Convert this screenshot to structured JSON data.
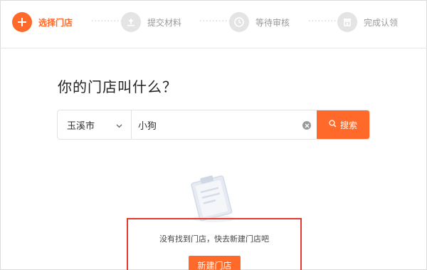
{
  "steps": [
    {
      "label": "选择门店",
      "icon": "plus-icon",
      "state": "active"
    },
    {
      "label": "提交材料",
      "icon": "upload-icon",
      "state": "inactive"
    },
    {
      "label": "等待审核",
      "icon": "clock-icon",
      "state": "inactive"
    },
    {
      "label": "完成认领",
      "icon": "store-icon",
      "state": "inactive"
    }
  ],
  "step_separator": "··········",
  "title": "你的门店叫什么？",
  "search": {
    "city": "玉溪市",
    "query": "小狗",
    "button_label": "搜索"
  },
  "empty_state": {
    "message": "没有找到门店，快去新建门店吧",
    "button_label": "新建门店"
  },
  "colors": {
    "accent": "#ff6a2b",
    "highlight_border": "#e03a2f",
    "inactive": "#e4e4e4"
  }
}
